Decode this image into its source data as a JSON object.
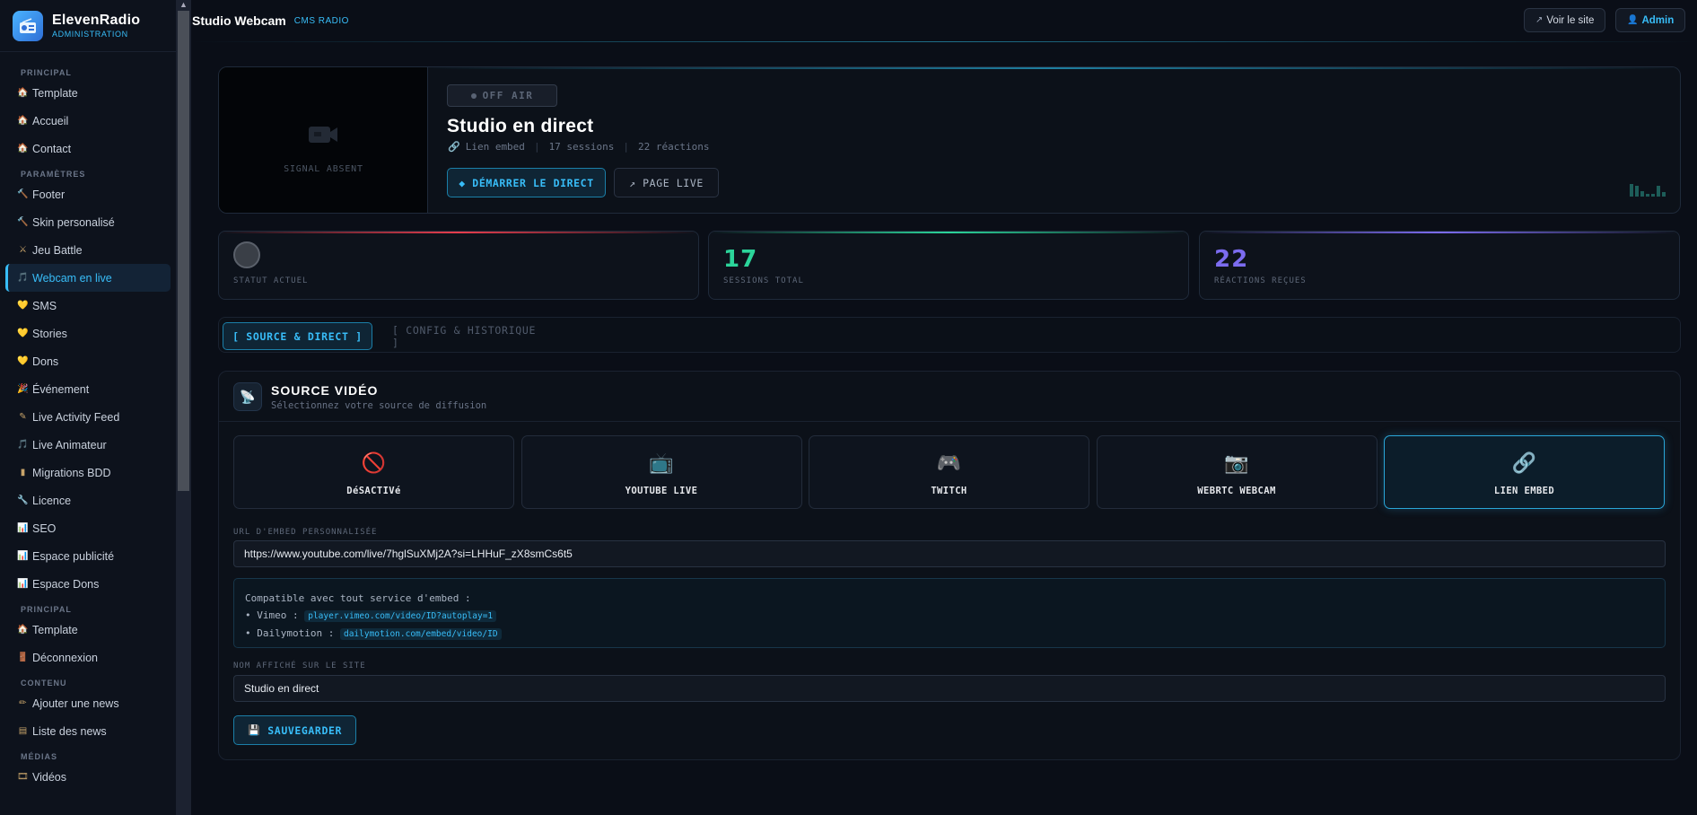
{
  "brand": {
    "name": "ElevenRadio",
    "subtitle": "ADMINISTRATION"
  },
  "sidebar": {
    "sections": [
      {
        "label": "PRINCIPAL",
        "items": [
          {
            "label": "Template",
            "icon": "home-icon"
          },
          {
            "label": "Accueil",
            "icon": "home-icon"
          },
          {
            "label": "Contact",
            "icon": "home-icon"
          }
        ]
      },
      {
        "label": "PARAMÈTRES",
        "items": [
          {
            "label": "Footer",
            "icon": "hammer-icon"
          },
          {
            "label": "Skin personalisé",
            "icon": "hammer-icon"
          },
          {
            "label": "Jeu Battle",
            "icon": "swords-icon"
          },
          {
            "label": "Webcam en live",
            "icon": "music-icon",
            "active": true
          },
          {
            "label": "SMS",
            "icon": "heart-icon"
          },
          {
            "label": "Stories",
            "icon": "heart-icon"
          },
          {
            "label": "Dons",
            "icon": "heart-icon"
          },
          {
            "label": "Événement",
            "icon": "party-icon"
          },
          {
            "label": "Live Activity Feed",
            "icon": "pen-icon"
          },
          {
            "label": "Live Animateur",
            "icon": "music-icon"
          },
          {
            "label": "Migrations BDD",
            "icon": "db-icon"
          },
          {
            "label": "Licence",
            "icon": "key-icon"
          },
          {
            "label": "SEO",
            "icon": "chart-icon"
          },
          {
            "label": "Espace publicité",
            "icon": "chart-icon"
          },
          {
            "label": "Espace Dons",
            "icon": "chart-icon"
          }
        ]
      },
      {
        "label": "PRINCIPAL",
        "items": [
          {
            "label": "Template",
            "icon": "home-icon"
          },
          {
            "label": "Déconnexion",
            "icon": "door-icon"
          }
        ]
      },
      {
        "label": "CONTENU",
        "items": [
          {
            "label": "Ajouter une news",
            "icon": "pencil-icon"
          },
          {
            "label": "Liste des news",
            "icon": "list-icon"
          }
        ]
      },
      {
        "label": "MÉDIAS",
        "items": [
          {
            "label": "Vidéos",
            "icon": "film-icon"
          }
        ]
      }
    ]
  },
  "header": {
    "title": "Studio Webcam",
    "tag": "CMS RADIO",
    "view_site": "Voir le site",
    "admin": "Admin"
  },
  "hero": {
    "signal": "SIGNAL ABSENT",
    "status": "OFF AIR",
    "title": "Studio en direct",
    "meta_embed": "Lien embed",
    "meta_sessions": "17 sessions",
    "meta_reactions": "22 réactions",
    "start_button": "◆ DÉMARRER LE DIRECT",
    "page_button": "↗ PAGE LIVE"
  },
  "stats": {
    "status_label": "STATUT ACTUEL",
    "sessions_value": "17",
    "sessions_label": "SESSIONS TOTAL",
    "reactions_value": "22",
    "reactions_label": "RÉACTIONS REÇUES",
    "colors": {
      "sessions": "#2bd49a",
      "reactions": "#7c6cf0",
      "status": "#e63d4d"
    }
  },
  "tabs": {
    "source": "[ SOURCE & DIRECT ]",
    "config": "[ CONFIG & HISTORIQUE ]"
  },
  "source": {
    "title": "SOURCE VIDÉO",
    "subtitle": "Sélectionnez votre source de diffusion",
    "options": [
      {
        "label": "DéSACTIVé",
        "icon": "no-entry-icon",
        "glyph": "🚫"
      },
      {
        "label": "YOUTUBE LIVE",
        "icon": "tv-icon",
        "glyph": "📺"
      },
      {
        "label": "TWITCH",
        "icon": "gamepad-icon",
        "glyph": "🎮"
      },
      {
        "label": "WEBRTC WEBCAM",
        "icon": "camera-icon",
        "glyph": "📷"
      },
      {
        "label": "LIEN EMBED",
        "icon": "link-icon",
        "glyph": "🔗",
        "selected": true
      }
    ],
    "embed_label": "URL D'EMBED PERSONNALISÉE",
    "embed_value": "https://www.youtube.com/live/7hglSuXMj2A?si=LHHuF_zX8smCs6t5",
    "hint_intro": "Compatible avec tout service d'embed :",
    "hint_vimeo_label": "• Vimeo :",
    "hint_vimeo_code": "player.vimeo.com/video/ID?autoplay=1",
    "hint_daily_label": "• Dailymotion :",
    "hint_daily_code": "dailymotion.com/embed/video/ID",
    "name_label": "NOM AFFICHÉ SUR LE SITE",
    "name_value": "Studio en direct",
    "save_button": "SAUVEGARDER"
  }
}
